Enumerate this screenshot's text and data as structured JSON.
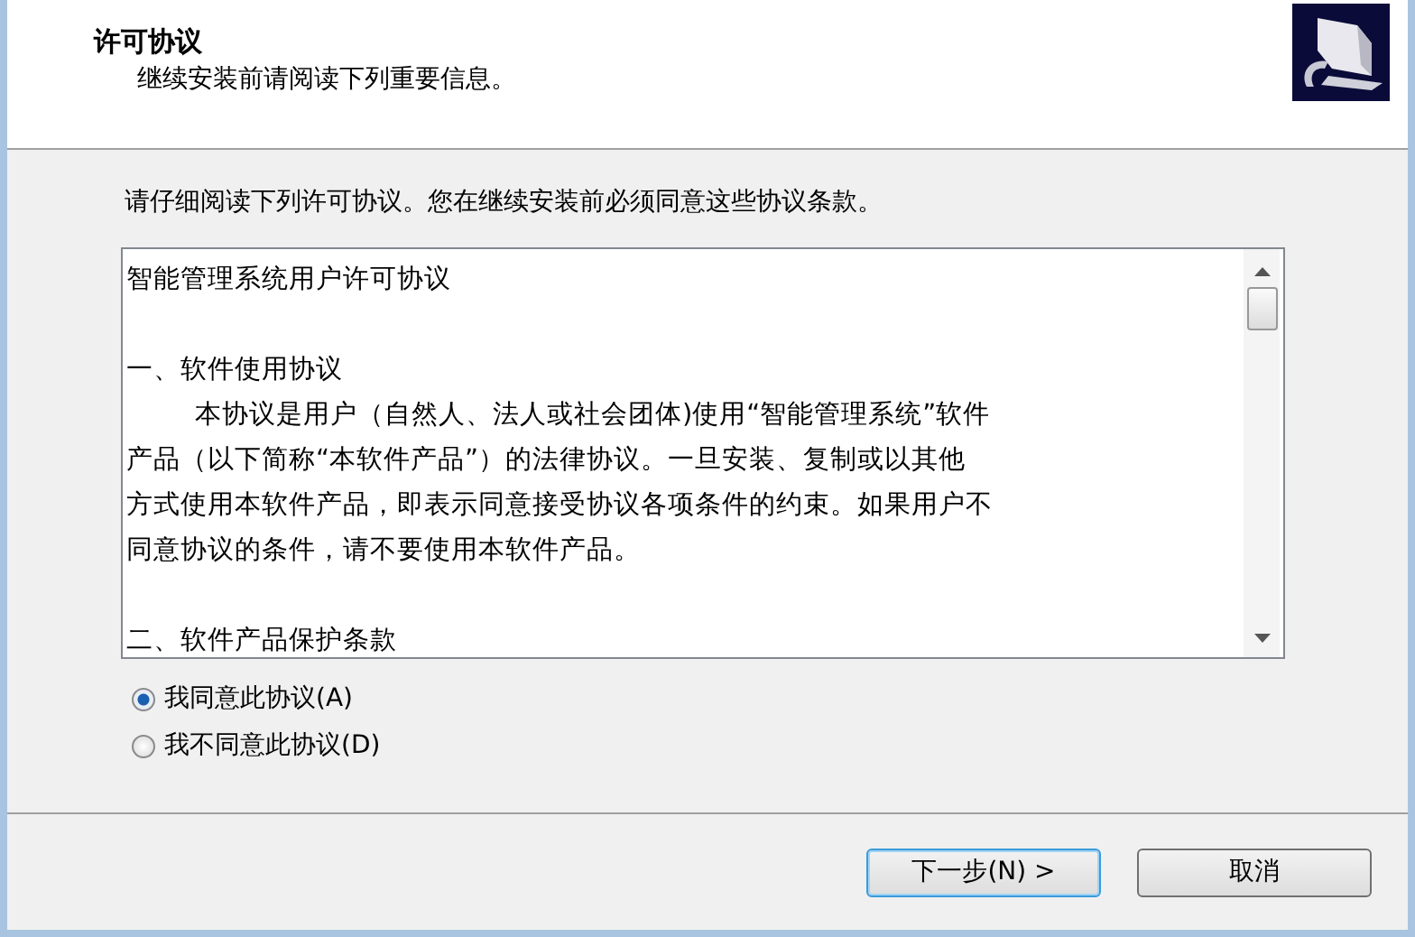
{
  "header": {
    "title": "许可协议",
    "subtitle": "继续安装前请阅读下列重要信息。"
  },
  "instruction": "请仔细阅读下列许可协议。您在继续安装前必须同意这些协议条款。",
  "license_text": {
    "lines": [
      {
        "kind": "text",
        "text": "智能管理系统用户许可协议",
        "indent": false
      },
      {
        "kind": "blank"
      },
      {
        "kind": "text",
        "text": "一、软件使用协议",
        "indent": false
      },
      {
        "kind": "text",
        "text": "本协议是用户（自然人、法人或社会团体)使用“智能管理系统”软件",
        "indent": true
      },
      {
        "kind": "text",
        "text": "产品（以下简称“本软件产品”）的法律协议。一旦安装、复制或以其他",
        "indent": false
      },
      {
        "kind": "text",
        "text": "方式使用本软件产品，即表示同意接受协议各项条件的约束。如果用户不",
        "indent": false
      },
      {
        "kind": "text",
        "text": "同意协议的条件，请不要使用本软件产品。",
        "indent": false
      },
      {
        "kind": "blank"
      },
      {
        "kind": "text",
        "text": "二、软件产品保护条款",
        "indent": false
      }
    ]
  },
  "options": [
    {
      "label": "我同意此协议(A)",
      "selected": true
    },
    {
      "label": "我不同意此协议(D)",
      "selected": false
    }
  ],
  "buttons": [
    {
      "label": "下一步(N) >",
      "focused": true
    },
    {
      "label": "取消",
      "focused": false
    }
  ]
}
